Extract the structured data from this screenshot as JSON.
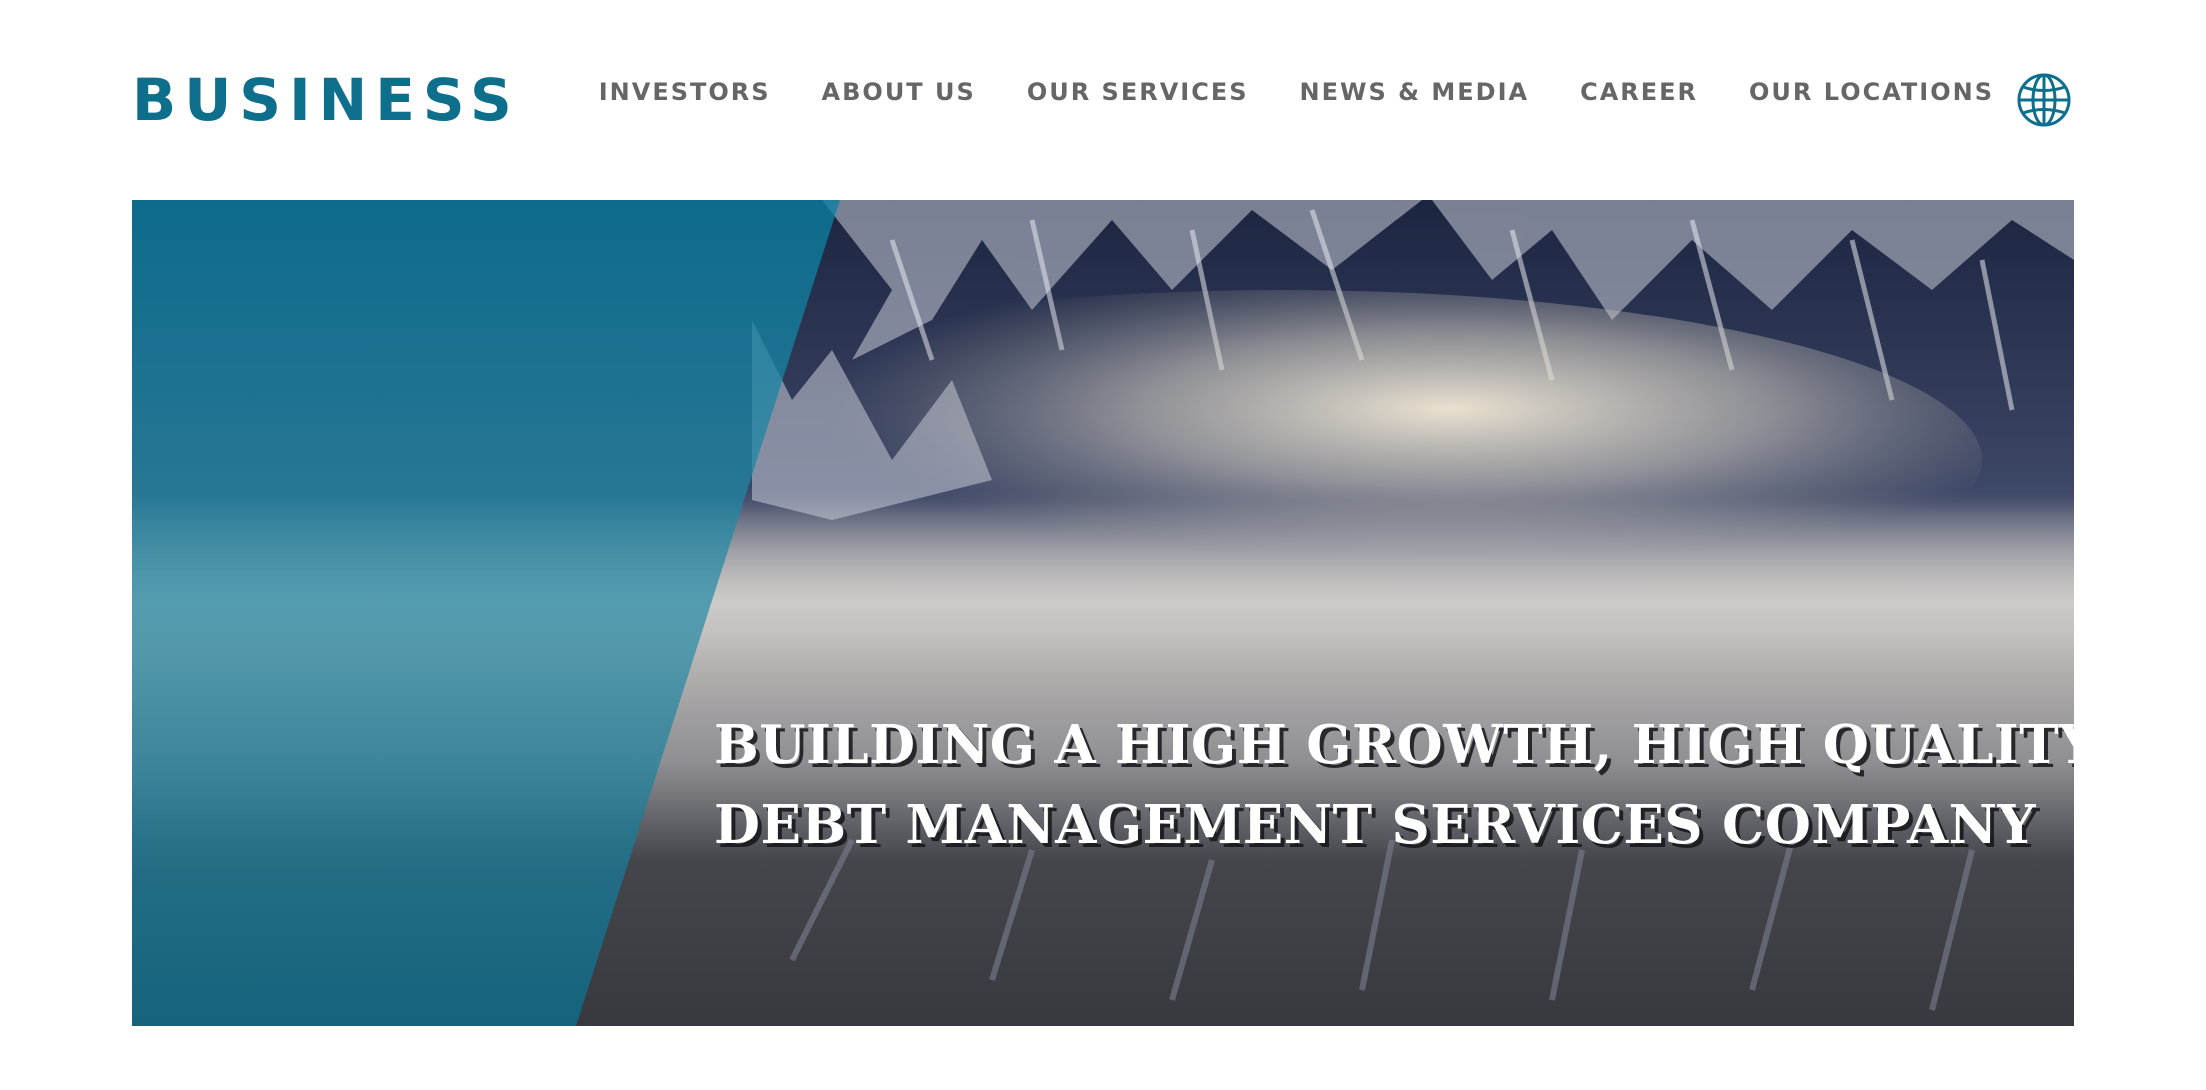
{
  "brand": {
    "logo_text": "BUSINESS",
    "color": "#0e6f8d"
  },
  "nav": {
    "items": [
      {
        "label": "INVESTORS"
      },
      {
        "label": "ABOUT US"
      },
      {
        "label": "OUR SERVICES"
      },
      {
        "label": "NEWS & MEDIA"
      },
      {
        "label": "CAREER"
      },
      {
        "label": "OUR LOCATIONS"
      }
    ],
    "language_icon": "globe-icon"
  },
  "hero": {
    "title_line1": "BUILDING A HIGH GROWTH, HIGH QUALITY",
    "title_line2": "DEBT MANAGEMENT SERVICES COMPANY",
    "overlay_color": "#0b7fa3",
    "image": "snowy mountains with clouds"
  }
}
